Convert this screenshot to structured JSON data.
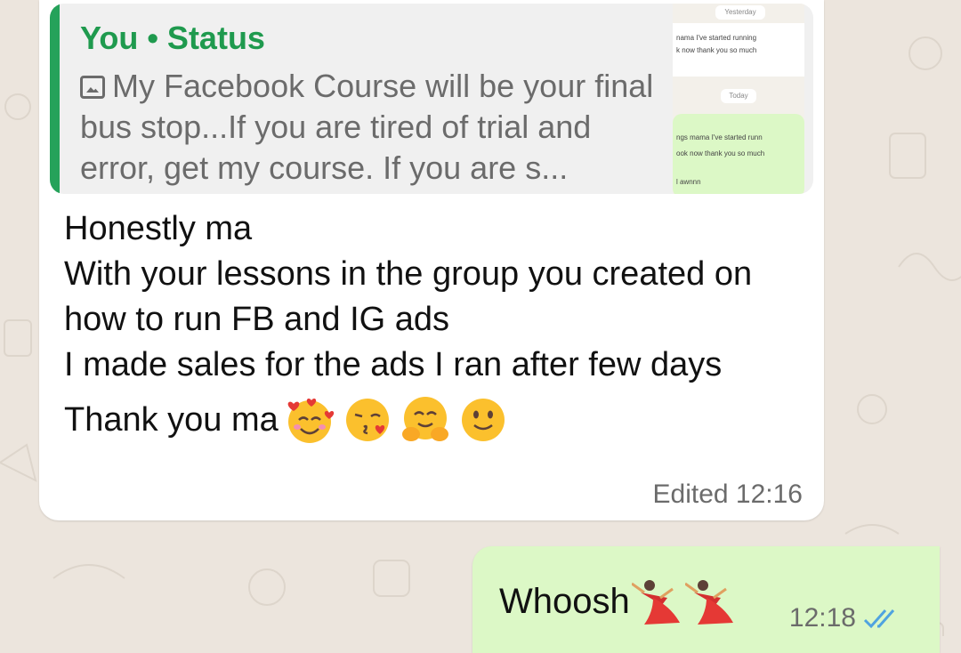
{
  "colors": {
    "wallpaper": "#ECE5DD",
    "incoming_bubble": "#FFFFFF",
    "outgoing_bubble": "#DCF8C6",
    "quote_accent": "#25A25A",
    "read_ticks": "#4FA3E0"
  },
  "incoming": {
    "quote": {
      "author": "You • Status",
      "icon": "image-icon",
      "text": "My Facebook Course will be your final bus stop...If you are tired of trial and error, get my course. If you are s...",
      "thumbnail": {
        "chip_top": "Yesterday",
        "line1": "nama I've started running",
        "line2": "k now thank you so much",
        "chip_mid": "Today",
        "line3": "ngs mama I've started runn",
        "line4": "ook now thank you so much",
        "line5": "l awnnn"
      }
    },
    "lines": [
      "Honestly ma",
      "With your lessons in the group you created on how to run FB and IG ads",
      "I made sales for the ads I ran after few days"
    ],
    "thanks_text": "Thank you ma",
    "emojis": [
      "smiling-face-with-hearts",
      "face-blowing-kiss",
      "hugging-face",
      "slightly-smiling-face"
    ],
    "edited_label": "Edited",
    "time": "12:16"
  },
  "outgoing": {
    "text": "Whoosh",
    "emojis": [
      "woman-dancing",
      "woman-dancing"
    ],
    "time": "12:18",
    "status_icon": "double-check-read-icon"
  }
}
